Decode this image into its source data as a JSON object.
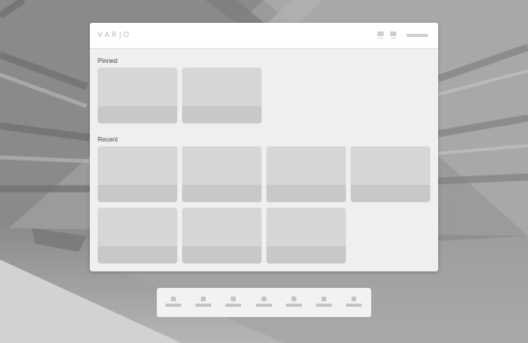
{
  "app": {
    "brand": "VARJO"
  },
  "header": {
    "icons": [
      "grid-view-icon",
      "list-view-icon"
    ],
    "menu_label_placeholder": ""
  },
  "sections": {
    "pinned": {
      "label": "Pinned",
      "card_count": 2
    },
    "recent": {
      "label": "Recent",
      "card_count": 7
    }
  },
  "dock": {
    "items": [
      "dock-item-1",
      "dock-item-2",
      "dock-item-3",
      "dock-item-4",
      "dock-item-5",
      "dock-item-6",
      "dock-item-7"
    ]
  },
  "colors": {
    "window_bg": "#efefef",
    "card_thumb": "#d6d6d6",
    "card_caption": "#c8c8c8",
    "header_bg": "#ffffff"
  }
}
